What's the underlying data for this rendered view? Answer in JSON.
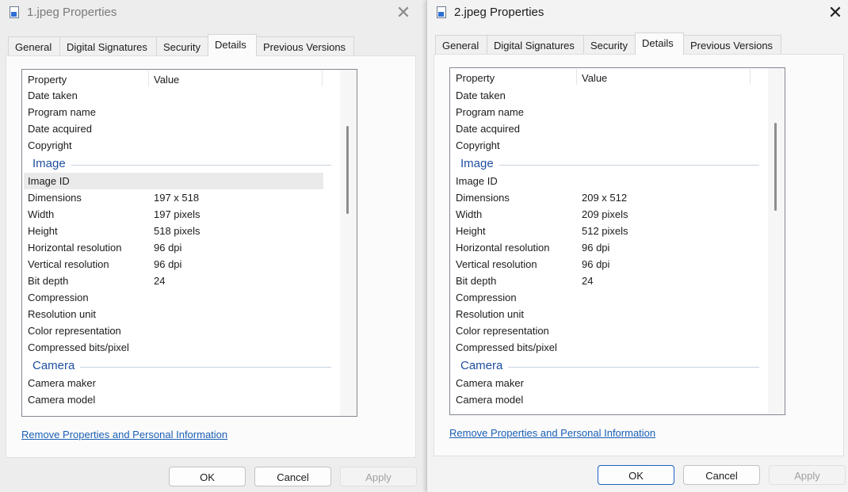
{
  "windows": [
    {
      "title": "1.jpeg Properties",
      "close_glyph": "✕",
      "tabs": [
        "General",
        "Digital Signatures",
        "Security",
        "Details",
        "Previous Versions"
      ],
      "active_tab": "Details",
      "columns": {
        "property": "Property",
        "value": "Value"
      },
      "rows": [
        {
          "kind": "prop",
          "name": "Date taken",
          "value": ""
        },
        {
          "kind": "prop",
          "name": "Program name",
          "value": ""
        },
        {
          "kind": "prop",
          "name": "Date acquired",
          "value": ""
        },
        {
          "kind": "prop",
          "name": "Copyright",
          "value": ""
        },
        {
          "kind": "group",
          "name": "Image"
        },
        {
          "kind": "prop",
          "name": "Image ID",
          "value": "",
          "selected": true
        },
        {
          "kind": "prop",
          "name": "Dimensions",
          "value": "197 x 518"
        },
        {
          "kind": "prop",
          "name": "Width",
          "value": "197 pixels"
        },
        {
          "kind": "prop",
          "name": "Height",
          "value": "518 pixels"
        },
        {
          "kind": "prop",
          "name": "Horizontal resolution",
          "value": "96 dpi"
        },
        {
          "kind": "prop",
          "name": "Vertical resolution",
          "value": "96 dpi"
        },
        {
          "kind": "prop",
          "name": "Bit depth",
          "value": "24"
        },
        {
          "kind": "prop",
          "name": "Compression",
          "value": ""
        },
        {
          "kind": "prop",
          "name": "Resolution unit",
          "value": ""
        },
        {
          "kind": "prop",
          "name": "Color representation",
          "value": ""
        },
        {
          "kind": "prop",
          "name": "Compressed bits/pixel",
          "value": ""
        },
        {
          "kind": "group",
          "name": "Camera"
        },
        {
          "kind": "prop",
          "name": "Camera maker",
          "value": ""
        },
        {
          "kind": "prop",
          "name": "Camera model",
          "value": ""
        }
      ],
      "link": "Remove Properties and Personal Information",
      "buttons": {
        "ok": "OK",
        "cancel": "Cancel",
        "apply": "Apply"
      }
    },
    {
      "title": "2.jpeg Properties",
      "close_glyph": "✕",
      "tabs": [
        "General",
        "Digital Signatures",
        "Security",
        "Details",
        "Previous Versions"
      ],
      "active_tab": "Details",
      "columns": {
        "property": "Property",
        "value": "Value"
      },
      "rows": [
        {
          "kind": "prop",
          "name": "Date taken",
          "value": ""
        },
        {
          "kind": "prop",
          "name": "Program name",
          "value": ""
        },
        {
          "kind": "prop",
          "name": "Date acquired",
          "value": ""
        },
        {
          "kind": "prop",
          "name": "Copyright",
          "value": ""
        },
        {
          "kind": "group",
          "name": "Image"
        },
        {
          "kind": "prop",
          "name": "Image ID",
          "value": ""
        },
        {
          "kind": "prop",
          "name": "Dimensions",
          "value": "209 x 512"
        },
        {
          "kind": "prop",
          "name": "Width",
          "value": "209 pixels"
        },
        {
          "kind": "prop",
          "name": "Height",
          "value": "512 pixels"
        },
        {
          "kind": "prop",
          "name": "Horizontal resolution",
          "value": "96 dpi"
        },
        {
          "kind": "prop",
          "name": "Vertical resolution",
          "value": "96 dpi"
        },
        {
          "kind": "prop",
          "name": "Bit depth",
          "value": "24"
        },
        {
          "kind": "prop",
          "name": "Compression",
          "value": ""
        },
        {
          "kind": "prop",
          "name": "Resolution unit",
          "value": ""
        },
        {
          "kind": "prop",
          "name": "Color representation",
          "value": ""
        },
        {
          "kind": "prop",
          "name": "Compressed bits/pixel",
          "value": ""
        },
        {
          "kind": "group",
          "name": "Camera"
        },
        {
          "kind": "prop",
          "name": "Camera maker",
          "value": ""
        },
        {
          "kind": "prop",
          "name": "Camera model",
          "value": ""
        }
      ],
      "link": "Remove Properties and Personal Information",
      "buttons": {
        "ok": "OK",
        "cancel": "Cancel",
        "apply": "Apply"
      }
    }
  ],
  "colors": {
    "group_heading": "#1f4e9e",
    "link": "#1a5fb4",
    "primary_border": "#1f62c2",
    "selected_row": "#eaeaea"
  }
}
